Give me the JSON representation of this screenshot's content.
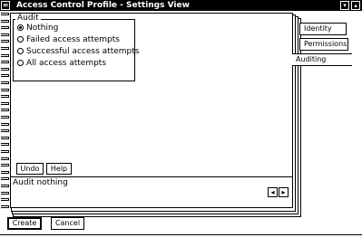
{
  "window": {
    "title": "Access Control Profile - Settings View",
    "sysmenu_icon": "system-menu-icon",
    "minimize_glyph": "▾",
    "maximize_glyph": "▴"
  },
  "tabs": [
    {
      "label": "Identity"
    },
    {
      "label": "Permissions"
    },
    {
      "label": "Auditing"
    }
  ],
  "audit_group": {
    "title": "Audit",
    "options": [
      {
        "label": "Nothing",
        "selected": true
      },
      {
        "label": "Failed access attempts",
        "selected": false
      },
      {
        "label": "Successful access attempts",
        "selected": false
      },
      {
        "label": "All access attempts",
        "selected": false
      }
    ]
  },
  "page_buttons": {
    "undo_label": "Undo",
    "help_label": "Help"
  },
  "status": {
    "text": "Audit nothing",
    "prev_glyph": "◂",
    "next_glyph": "▸"
  },
  "footer": {
    "create_label": "Create",
    "cancel_label": "Cancel"
  }
}
